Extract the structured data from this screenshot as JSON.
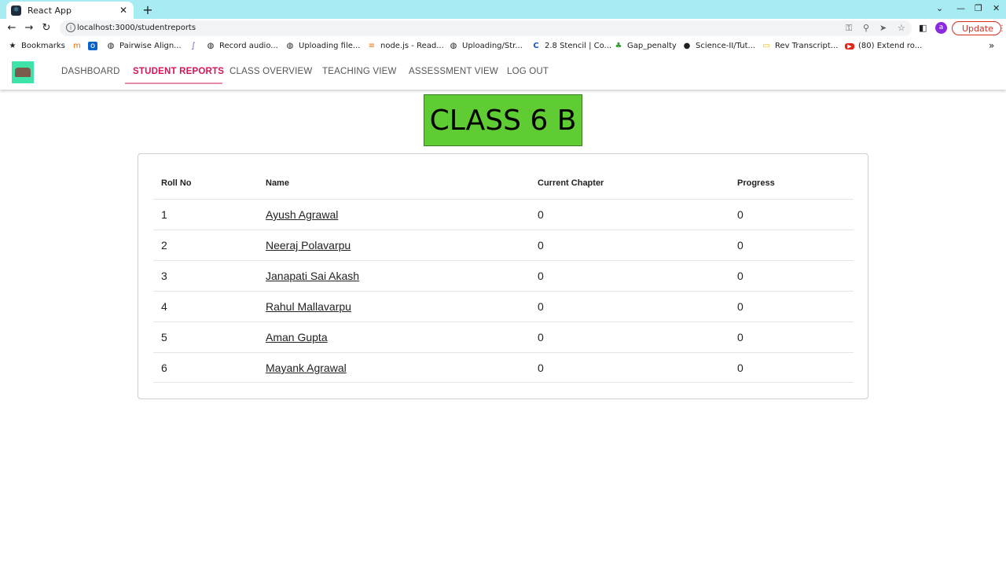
{
  "browser": {
    "tab_title": "React App",
    "url": "localhost:3000/studentreports",
    "update_label": "Update",
    "profile_initial": "a",
    "bookmarks": [
      {
        "label": "Bookmarks",
        "icon": "star-icon"
      },
      {
        "label": "",
        "icon": "bookmark-m-icon"
      },
      {
        "label": "",
        "icon": "outlook-icon"
      },
      {
        "label": "Pairwise Align...",
        "icon": "globe-icon"
      },
      {
        "label": "",
        "icon": "bookmark-squiggle-icon"
      },
      {
        "label": "Record audio...",
        "icon": "globe-icon"
      },
      {
        "label": "Uploading file...",
        "icon": "globe-icon"
      },
      {
        "label": "node.js - Read...",
        "icon": "stackoverflow-icon"
      },
      {
        "label": "Uploading/Str...",
        "icon": "globe-icon"
      },
      {
        "label": "2.8 Stencil | Co...",
        "icon": "c-logo-icon"
      },
      {
        "label": "Gap_penalty",
        "icon": "leaf-icon"
      },
      {
        "label": "Science-II/Tut...",
        "icon": "github-icon"
      },
      {
        "label": "Rev Transcript...",
        "icon": "folder-icon"
      },
      {
        "label": "(80) Extend ro...",
        "icon": "youtube-icon"
      }
    ]
  },
  "nav": {
    "items": [
      {
        "label": "DASHBOARD",
        "active": false
      },
      {
        "label": "STUDENT REPORTS",
        "active": true
      },
      {
        "label": "CLASS OVERVIEW",
        "active": false
      },
      {
        "label": "TEACHING VIEW",
        "active": false
      },
      {
        "label": "ASSESSMENT VIEW",
        "active": false
      },
      {
        "label": "LOG OUT",
        "active": false
      }
    ]
  },
  "class_title": "CLASS 6 B",
  "table": {
    "headers": [
      "Roll No",
      "Name",
      "Current Chapter",
      "Progress"
    ],
    "rows": [
      {
        "roll": "1",
        "name": "Ayush Agrawal",
        "chapter": "0",
        "progress": "0"
      },
      {
        "roll": "2",
        "name": "Neeraj Polavarpu",
        "chapter": "0",
        "progress": "0"
      },
      {
        "roll": "3",
        "name": "Janapati Sai Akash",
        "chapter": "0",
        "progress": "0"
      },
      {
        "roll": "4",
        "name": "Rahul Mallavarpu",
        "chapter": "0",
        "progress": "0"
      },
      {
        "roll": "5",
        "name": "Aman Gupta",
        "chapter": "0",
        "progress": "0"
      },
      {
        "roll": "6",
        "name": "Mayank Agrawal",
        "chapter": "0",
        "progress": "0"
      }
    ]
  }
}
